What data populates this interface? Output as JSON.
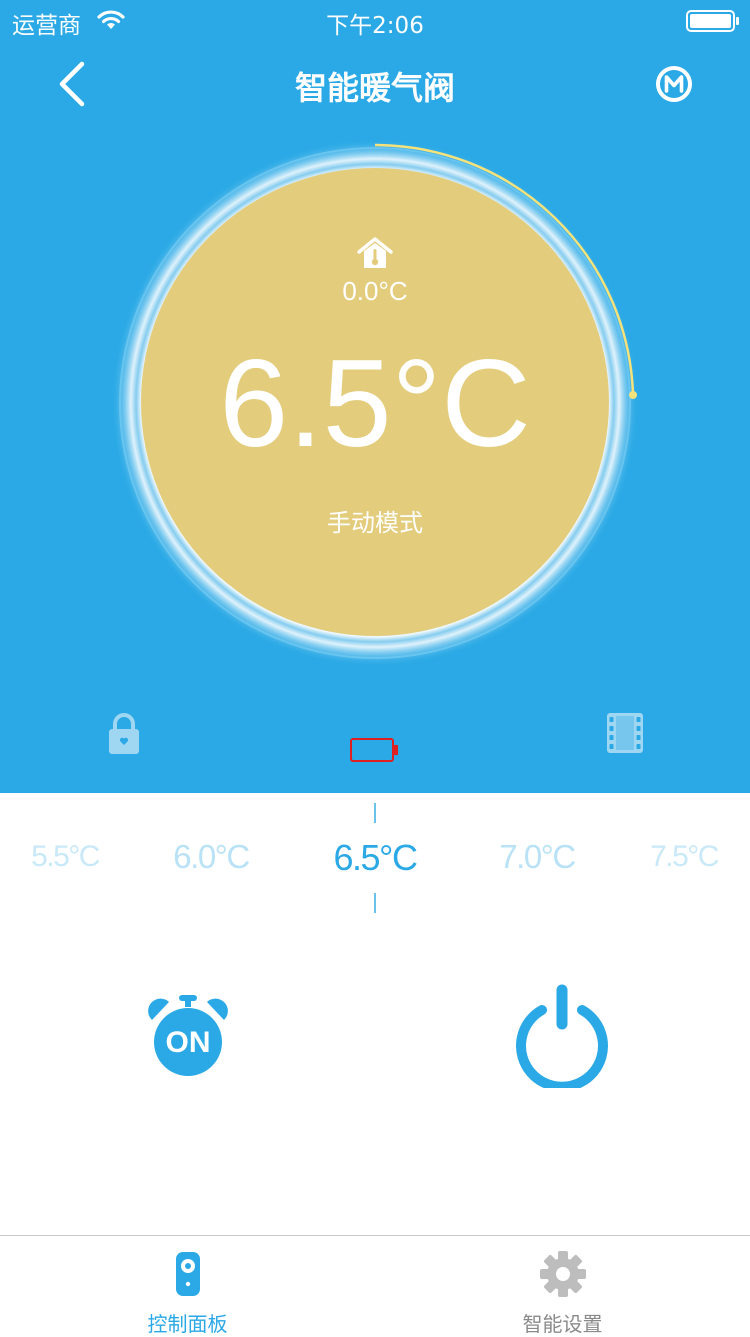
{
  "status_bar": {
    "carrier": "运营商",
    "time": "下午2:06",
    "wifi_icon": "wifi-icon",
    "battery_icon": "battery-full-icon"
  },
  "nav": {
    "title": "智能暖气阀",
    "back_icon": "chevron-left-icon",
    "mode_icon": "mode-m-icon"
  },
  "thermostat": {
    "room_temp_icon": "home-thermometer-icon",
    "current_temp": "0.0°C",
    "set_temp": "6.5°C",
    "mode": "手动模式",
    "face_color": "#e3cc7c",
    "arc_color": "#f5e27a"
  },
  "status_icons": {
    "lock": "lock-icon",
    "battery": "battery-low-icon",
    "window": "window-film-icon"
  },
  "picker": {
    "values": [
      "5.5°C",
      "6.0°C",
      "6.5°C",
      "7.0°C",
      "7.5°C"
    ],
    "selected": "6.5°C"
  },
  "controls": {
    "timer_label": "ON",
    "timer_icon": "alarm-clock-icon",
    "power_icon": "power-icon"
  },
  "tabs": [
    {
      "label": "控制面板",
      "icon": "remote-control-icon",
      "active": true
    },
    {
      "label": "智能设置",
      "icon": "gear-icon",
      "active": false
    }
  ],
  "colors": {
    "primary": "#2aa9e6",
    "inactive_tab": "#8a8a8a",
    "battery_alert": "#e02020"
  }
}
